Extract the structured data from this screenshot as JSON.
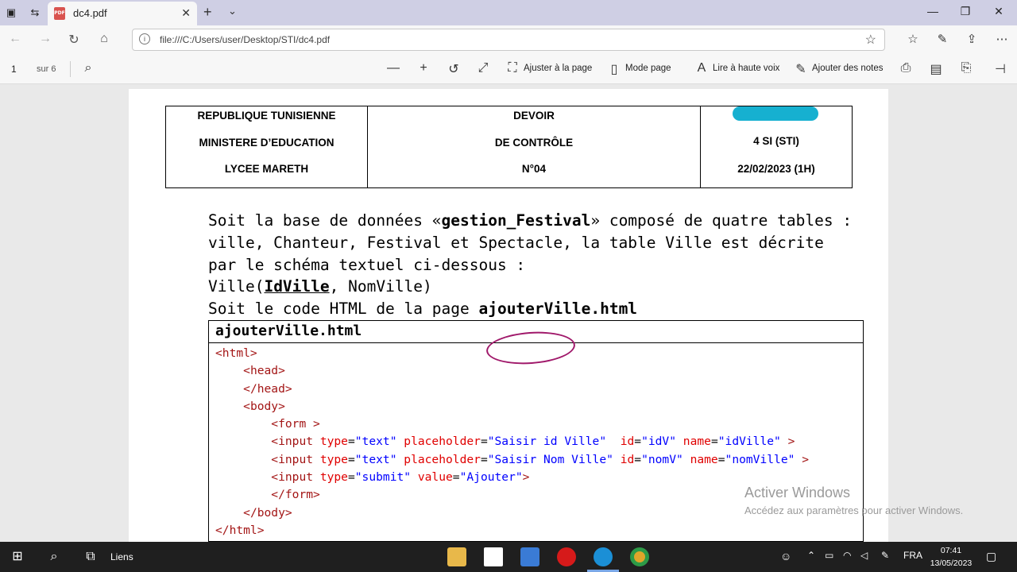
{
  "browser": {
    "tab_title": "dc4.pdf",
    "url": "file:///C:/Users/user/Desktop/STI/dc4.pdf",
    "icons": [
      "back-icon",
      "forward-icon",
      "refresh-icon",
      "home-icon",
      "info-icon",
      "star-icon",
      "favorites-icon",
      "pen-icon",
      "share-icon",
      "more-icon"
    ]
  },
  "pdf_toolbar": {
    "page_number": "1",
    "page_count": "sur 6",
    "fit_label": "Ajuster à la page",
    "page_mode_label": "Mode page",
    "read_aloud_label": "Lire à haute voix",
    "add_notes_label": "Ajouter des notes"
  },
  "document": {
    "header": {
      "left": [
        "REPUBLIQUE TUNISIENNE",
        "MINISTERE D’EDUCATION",
        "LYCEE MARETH"
      ],
      "center": [
        "DEVOIR",
        "DE CONTRÔLE",
        "N°04"
      ],
      "right": [
        "4 SI (STI)",
        "22/02/2023 (1H)"
      ]
    },
    "paragraph": {
      "line1_a": "Soit la base de données «",
      "line1_bold": "gestion_Festival",
      "line1_b": "» composé de quatre tables :",
      "line2": "ville, Chanteur, Festival et Spectacle, la table Ville est décrite",
      "line3": "par le schéma textuel ci-dessous :",
      "line4_a": "Ville(",
      "line4_key": "IdVille",
      "line4_b": ", NomVille)",
      "line5_a": "Soit le code HTML de la page ",
      "line5_bold": "ajouterVille.html"
    },
    "code_caption": "ajouterVille.html",
    "code": {
      "html_open": "<html>",
      "head_open": "<head>",
      "head_close": "</head>",
      "body_open": "<body>",
      "form_open": "<form >",
      "input1": {
        "type": "\"text\"",
        "placeholder": "\"Saisir id Ville\"",
        "id": "\"idV\"",
        "name": "\"idVille\""
      },
      "input2": {
        "type": "\"text\"",
        "placeholder": "\"Saisir Nom Ville\"",
        "id": "\"nomV\"",
        "name": "\"nomVille\""
      },
      "input3": {
        "type": "\"submit\"",
        "value": "\"Ajouter\""
      },
      "form_close": "</form>",
      "body_close": "</body>",
      "html_close": "</html>"
    }
  },
  "watermark": {
    "title": "Activer Windows",
    "subtitle": "Accédez aux paramètres pour activer Windows."
  },
  "taskbar": {
    "links_label": "Liens",
    "lang": "FRA",
    "time": "07:41",
    "date": "13/05/2023"
  },
  "colors": {
    "tabbar": "#cfcfe4",
    "code_tag": "#a31515",
    "code_attr": "#e00000",
    "code_value": "#0000ff",
    "annotation_circle": "#a0186a",
    "redaction": "#16b0d0"
  }
}
